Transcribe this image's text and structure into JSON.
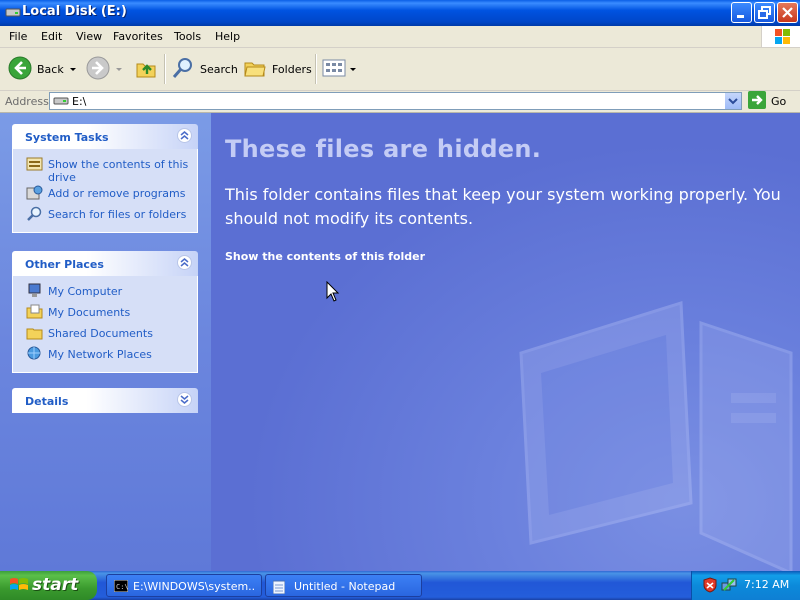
{
  "window": {
    "title": "Local Disk (E:)"
  },
  "menu": [
    "File",
    "Edit",
    "View",
    "Favorites",
    "Tools",
    "Help"
  ],
  "toolbar": {
    "back_label": "Back",
    "search_label": "Search",
    "folders_label": "Folders"
  },
  "address": {
    "label": "Address",
    "value": "E:\\",
    "go_label": "Go"
  },
  "system_tasks": {
    "title": "System Tasks",
    "items": [
      "Show the contents of this drive",
      "Add or remove programs",
      "Search for files or folders"
    ]
  },
  "other_places": {
    "title": "Other Places",
    "items": [
      "My Computer",
      "My Documents",
      "Shared Documents",
      "My Network Places"
    ]
  },
  "details": {
    "title": "Details"
  },
  "content": {
    "heading": "These files are hidden.",
    "description": "This folder contains files that keep your system working properly. You should not modify its contents.",
    "link": "Show the contents of this folder"
  },
  "taskbar": {
    "start_label": "start",
    "buttons": [
      "E:\\WINDOWS\\system...",
      "Untitled - Notepad"
    ],
    "clock": "7:12 AM"
  },
  "colors": {
    "titlebar": "#0053e1",
    "taskpane_link": "#215dc6",
    "content_bg": "#5b6fd3",
    "start_green": "#3a9a2e"
  }
}
